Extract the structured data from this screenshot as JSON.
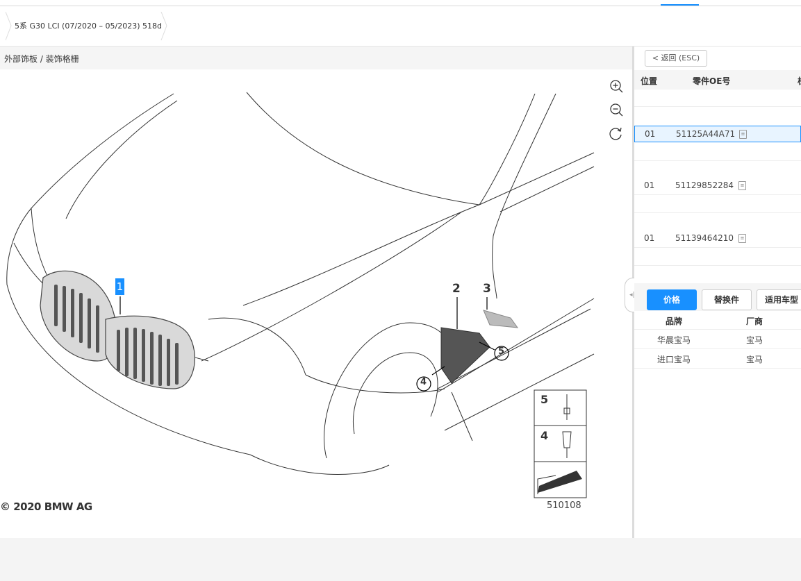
{
  "breadcrumb": {
    "label": "5系 G30 LCI (07/2020 – 05/2023) 518d"
  },
  "diagram": {
    "path": "外部饰板 / 装饰格栅",
    "copyright": "© 2020 BMW AG",
    "drawing_number": "510108",
    "callouts": [
      "1",
      "2",
      "3",
      "4",
      "5"
    ],
    "legend_numbers": [
      "5",
      "4"
    ]
  },
  "zoom_controls": [
    "zoom-in-icon",
    "zoom-out-icon",
    "reset-icon"
  ],
  "right_panel": {
    "back_label": "< 返回 (ESC)",
    "columns": {
      "position": "位置",
      "oe": "零件OE号",
      "more": "栏"
    },
    "parts": [
      {
        "position": "01",
        "oe": "51125A44A71",
        "selected": true
      },
      {
        "position": "01",
        "oe": "51129852284",
        "selected": false
      },
      {
        "position": "01",
        "oe": "51139464210",
        "selected": false
      }
    ],
    "tabs": [
      "价格",
      "替换件",
      "适用车型"
    ],
    "price_columns": {
      "brand": "品牌",
      "maker": "厂商"
    },
    "price_rows": [
      {
        "brand": "华晨宝马",
        "maker": "宝马"
      },
      {
        "brand": "进口宝马",
        "maker": "宝马"
      }
    ]
  },
  "colors": {
    "accent": "#1890ff",
    "callout_fill": "#1890ff"
  }
}
